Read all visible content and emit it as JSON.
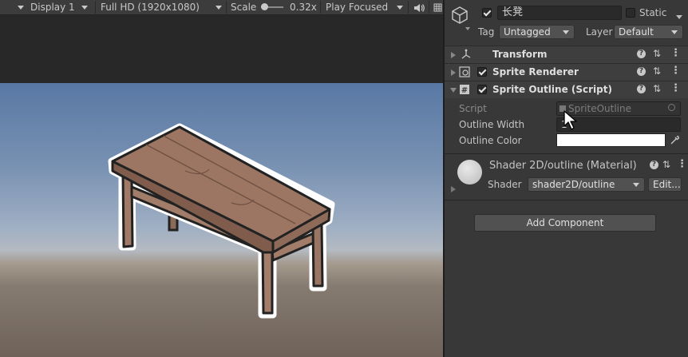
{
  "game_toolbar": {
    "display": "Display 1",
    "resolution": "Full HD (1920x1080)",
    "scale_label": "Scale",
    "scale_value": "0.32x",
    "play_mode": "Play Focused",
    "audio_icon": "speaker-icon",
    "stats_icon": "grid-icon"
  },
  "inspector": {
    "object_icon": "cube-icon",
    "object_name": "长凳",
    "static_label": "Static",
    "tag_label": "Tag",
    "tag_value": "Untagged",
    "layer_label": "Layer",
    "layer_value": "Default",
    "components": [
      {
        "title": "Transform",
        "icon": "transform-icon"
      },
      {
        "title": "Sprite Renderer",
        "icon": "sprite-renderer-icon"
      },
      {
        "title": "Sprite Outline (Script)",
        "icon": "script-icon"
      }
    ],
    "script_props": {
      "script_label": "Script",
      "script_value": "SpriteOutline",
      "width_label": "Outline Width",
      "width_value": "1",
      "color_label": "Outline Color",
      "color_value": "#ffffff"
    },
    "material": {
      "title": "Shader 2D/outline (Material)",
      "shader_label": "Shader",
      "shader_value": "shader2D/outline",
      "edit_label": "Edit..."
    },
    "add_component": "Add Component"
  },
  "colors": {
    "inspector_bg": "#383838",
    "sky_top": "#5878a4",
    "ground": "#6e6259",
    "bench_wood": "#98725f"
  }
}
